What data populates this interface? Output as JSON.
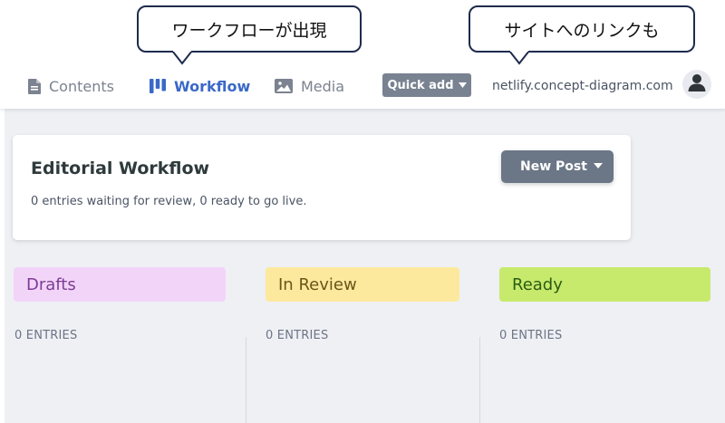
{
  "annotations": {
    "workflow_callout": "ワークフローが出現",
    "site_callout": "サイトへのリンクも"
  },
  "nav": {
    "contents_label": "Contents",
    "workflow_label": "Workflow",
    "media_label": "Media",
    "active_tab": "workflow",
    "quick_add_label": "Quick add",
    "site_url": "netlify.concept-diagram.com"
  },
  "workflow_card": {
    "title": "Editorial Workflow",
    "description": "0 entries waiting for review, 0 ready to go live.",
    "new_post_label": "New Post"
  },
  "columns": [
    {
      "title": "Drafts",
      "count_label": "0 ENTRIES",
      "color": "#f2d4f9",
      "text_color": "#7c3d93"
    },
    {
      "title": "In Review",
      "count_label": "0 ENTRIES",
      "color": "#fde99e",
      "text_color": "#6c5418"
    },
    {
      "title": "Ready",
      "count_label": "0 ENTRIES",
      "color": "#c7ea6d",
      "text_color": "#2d5c12"
    }
  ],
  "colors": {
    "accent": "#3a69c7",
    "nav_text": "#7b8290",
    "button_bg": "#798291",
    "main_bg": "#eff0f4"
  },
  "icons": {
    "contents": "document-icon",
    "workflow": "kanban-icon",
    "media": "image-icon",
    "avatar": "user-icon"
  }
}
